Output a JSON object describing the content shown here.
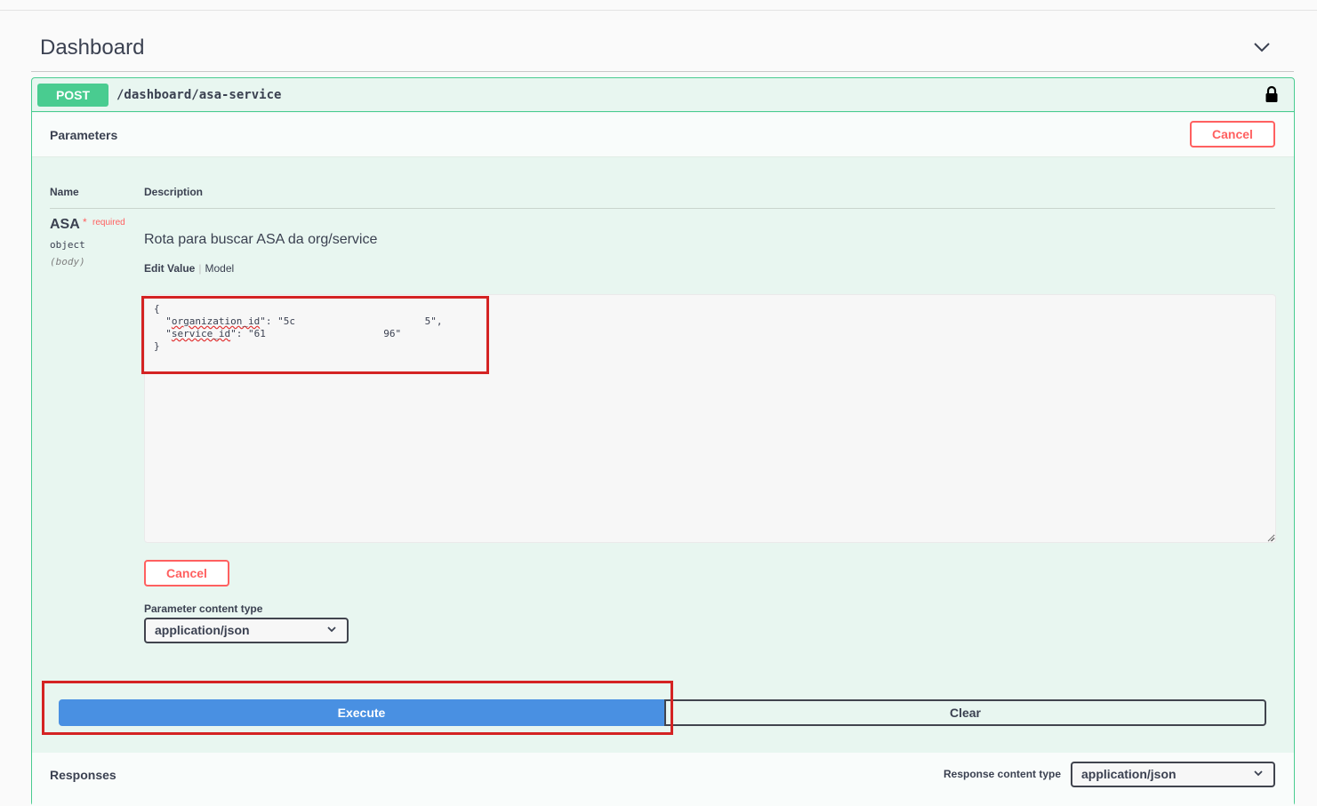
{
  "tag": {
    "title": "Dashboard"
  },
  "operation": {
    "method": "POST",
    "path": "/dashboard/asa-service"
  },
  "parameters": {
    "title": "Parameters",
    "cancel_label": "Cancel",
    "col_name": "Name",
    "col_description": "Description",
    "param": {
      "name": "ASA",
      "required_star": "*",
      "required_label": "required",
      "type": "object",
      "in": "(body)",
      "description": "Rota para buscar ASA da org/service",
      "tab_edit": "Edit Value",
      "tab_model": "Model",
      "body_line_1": "{",
      "body_key_1": "organization_id",
      "body_val_1": "\"5c                      5\",",
      "body_key_2": "service_id",
      "body_val_2": "\"61                    96\"",
      "body_line_4": "}"
    },
    "cancel_label_2": "Cancel",
    "content_type_label": "Parameter content type",
    "content_type_value": "application/json"
  },
  "actions": {
    "execute_label": "Execute",
    "clear_label": "Clear"
  },
  "responses": {
    "title": "Responses",
    "content_type_label": "Response content type",
    "content_type_value": "application/json"
  },
  "colors": {
    "post": "#49cc90",
    "execute": "#4990e2",
    "cancel": "#ff6060",
    "highlight": "#d42323"
  }
}
